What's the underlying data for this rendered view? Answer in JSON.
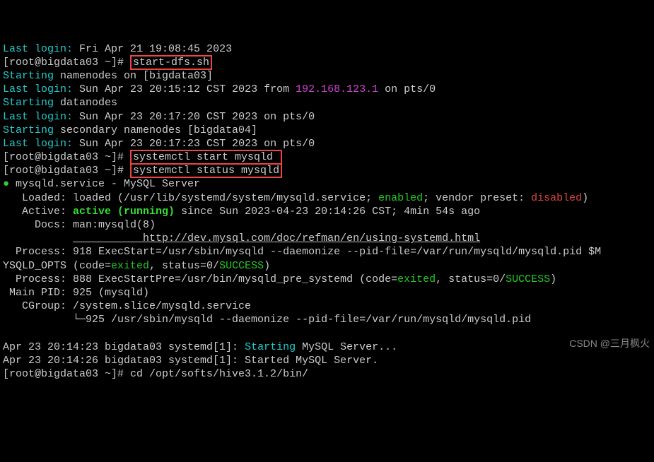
{
  "line1_a": "Last login:",
  "line1_b": " Fri Apr 21 19:08:45 2023",
  "p1_a": "[root@bigdata03 ~]# ",
  "cmd1": "start-dfs.sh",
  "line3": "Starting",
  "line3b": " namenodes on [bigdata03]",
  "line4a": "Last login:",
  "line4b": " Sun Apr 23 20:15:12 CST 2023 from ",
  "line4c": "192.168.123.1",
  "line4d": " on pts/0",
  "line5": "Starting",
  "line5b": " datanodes",
  "line6a": "Last login:",
  "line6b": " Sun Apr 23 20:17:20 CST 2023 on pts/0",
  "line7": "Starting",
  "line7b": " secondary namenodes [bigdata04]",
  "line8a": "Last login:",
  "line8b": " Sun Apr 23 20:17:23 CST 2023 on pts/0",
  "p2": "[root@bigdata03 ~]# ",
  "cmd2": "systemctl start mysqld ",
  "p3": "[root@bigdata03 ~]# ",
  "cmd3": "systemctl status mysqld",
  "svc1": " mysqld.service - MySQL Server",
  "svc2a": "   Loaded: loaded (/usr/lib/systemd/system/mysqld.service; ",
  "svc2b": "enabled",
  "svc2c": "; vendor preset: ",
  "svc2d": "disabled",
  "svc2e": ")",
  "svc3a": "   Active: ",
  "svc3b": "active (running)",
  "svc3c": " since Sun 2023-04-23 20:14:26 CST; 4min 54s ago",
  "svc4": "     Docs: man:mysqld(8)",
  "svc5": "           http://dev.mysql.com/doc/refman/en/using-systemd.html",
  "svc6a": "  Process: 918 ExecStart=/usr/sbin/mysqld --daemonize --pid-file=/var/run/mysqld/mysqld.pid $M",
  "svc6b": "YSQLD_OPTS (code=",
  "svc6c": "exited",
  "svc6d": ", status=0/",
  "svc6e": "SUCCESS",
  "svc6f": ")",
  "svc7a": "  Process: 888 ExecStartPre=/usr/bin/mysqld_pre_systemd (code=",
  "svc7b": "exited",
  "svc7c": ", status=0/",
  "svc7d": "SUCCESS",
  "svc7e": ")",
  "svc8": " Main PID: 925 (mysqld)",
  "svc9": "   CGroup: /system.slice/mysqld.service",
  "svc10": "           └─925 /usr/sbin/mysqld --daemonize --pid-file=/var/run/mysqld/mysqld.pid",
  "log1a": "Apr 23 20:14:23 bigdata03 systemd[1]: ",
  "log1b": "Starting",
  "log1c": " MySQL Server...",
  "log2": "Apr 23 20:14:26 bigdata03 systemd[1]: Started MySQL Server.",
  "p4": "[root@bigdata03 ~]# cd /opt/softs/hive3.1.2/bin/",
  "watermark": "CSDN @三月枫火"
}
